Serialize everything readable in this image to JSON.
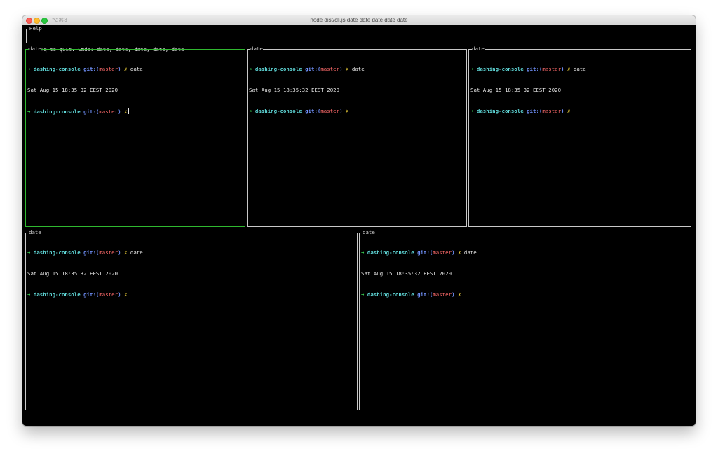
{
  "window": {
    "title": "node dist/cli.js date date date date date",
    "shortcut": "⌥⌘3"
  },
  "help": {
    "label": "Help",
    "text": "CTRL+q to quit. Cmds: date, date, date, date, date"
  },
  "prompt": {
    "arrow": "➜",
    "repo": "dashing-console",
    "git_prefix": "git:(",
    "branch": "master",
    "git_suffix": ")",
    "dirty": "✗"
  },
  "panels": [
    {
      "label": "date",
      "command": "date",
      "output": "Sat Aug 15 18:35:32 EEST 2020",
      "focused": true
    },
    {
      "label": "date",
      "command": "date",
      "output": "Sat Aug 15 18:35:32 EEST 2020",
      "focused": false
    },
    {
      "label": "date",
      "command": "date",
      "output": "Sat Aug 15 18:35:32 EEST 2020",
      "focused": false
    },
    {
      "label": "date",
      "command": "date",
      "output": "Sat Aug 15 18:35:32 EEST 2020",
      "focused": false
    },
    {
      "label": "date",
      "command": "date",
      "output": "Sat Aug 15 18:35:32 EEST 2020",
      "focused": false
    }
  ],
  "colors": {
    "focused_border": "#2fb82f",
    "border": "#c8c8c8",
    "arrow": "#39d353",
    "repo": "#5fd7d7",
    "git": "#6f8ff7",
    "branch": "#ff6b6b",
    "dirty": "#f2d33b"
  }
}
